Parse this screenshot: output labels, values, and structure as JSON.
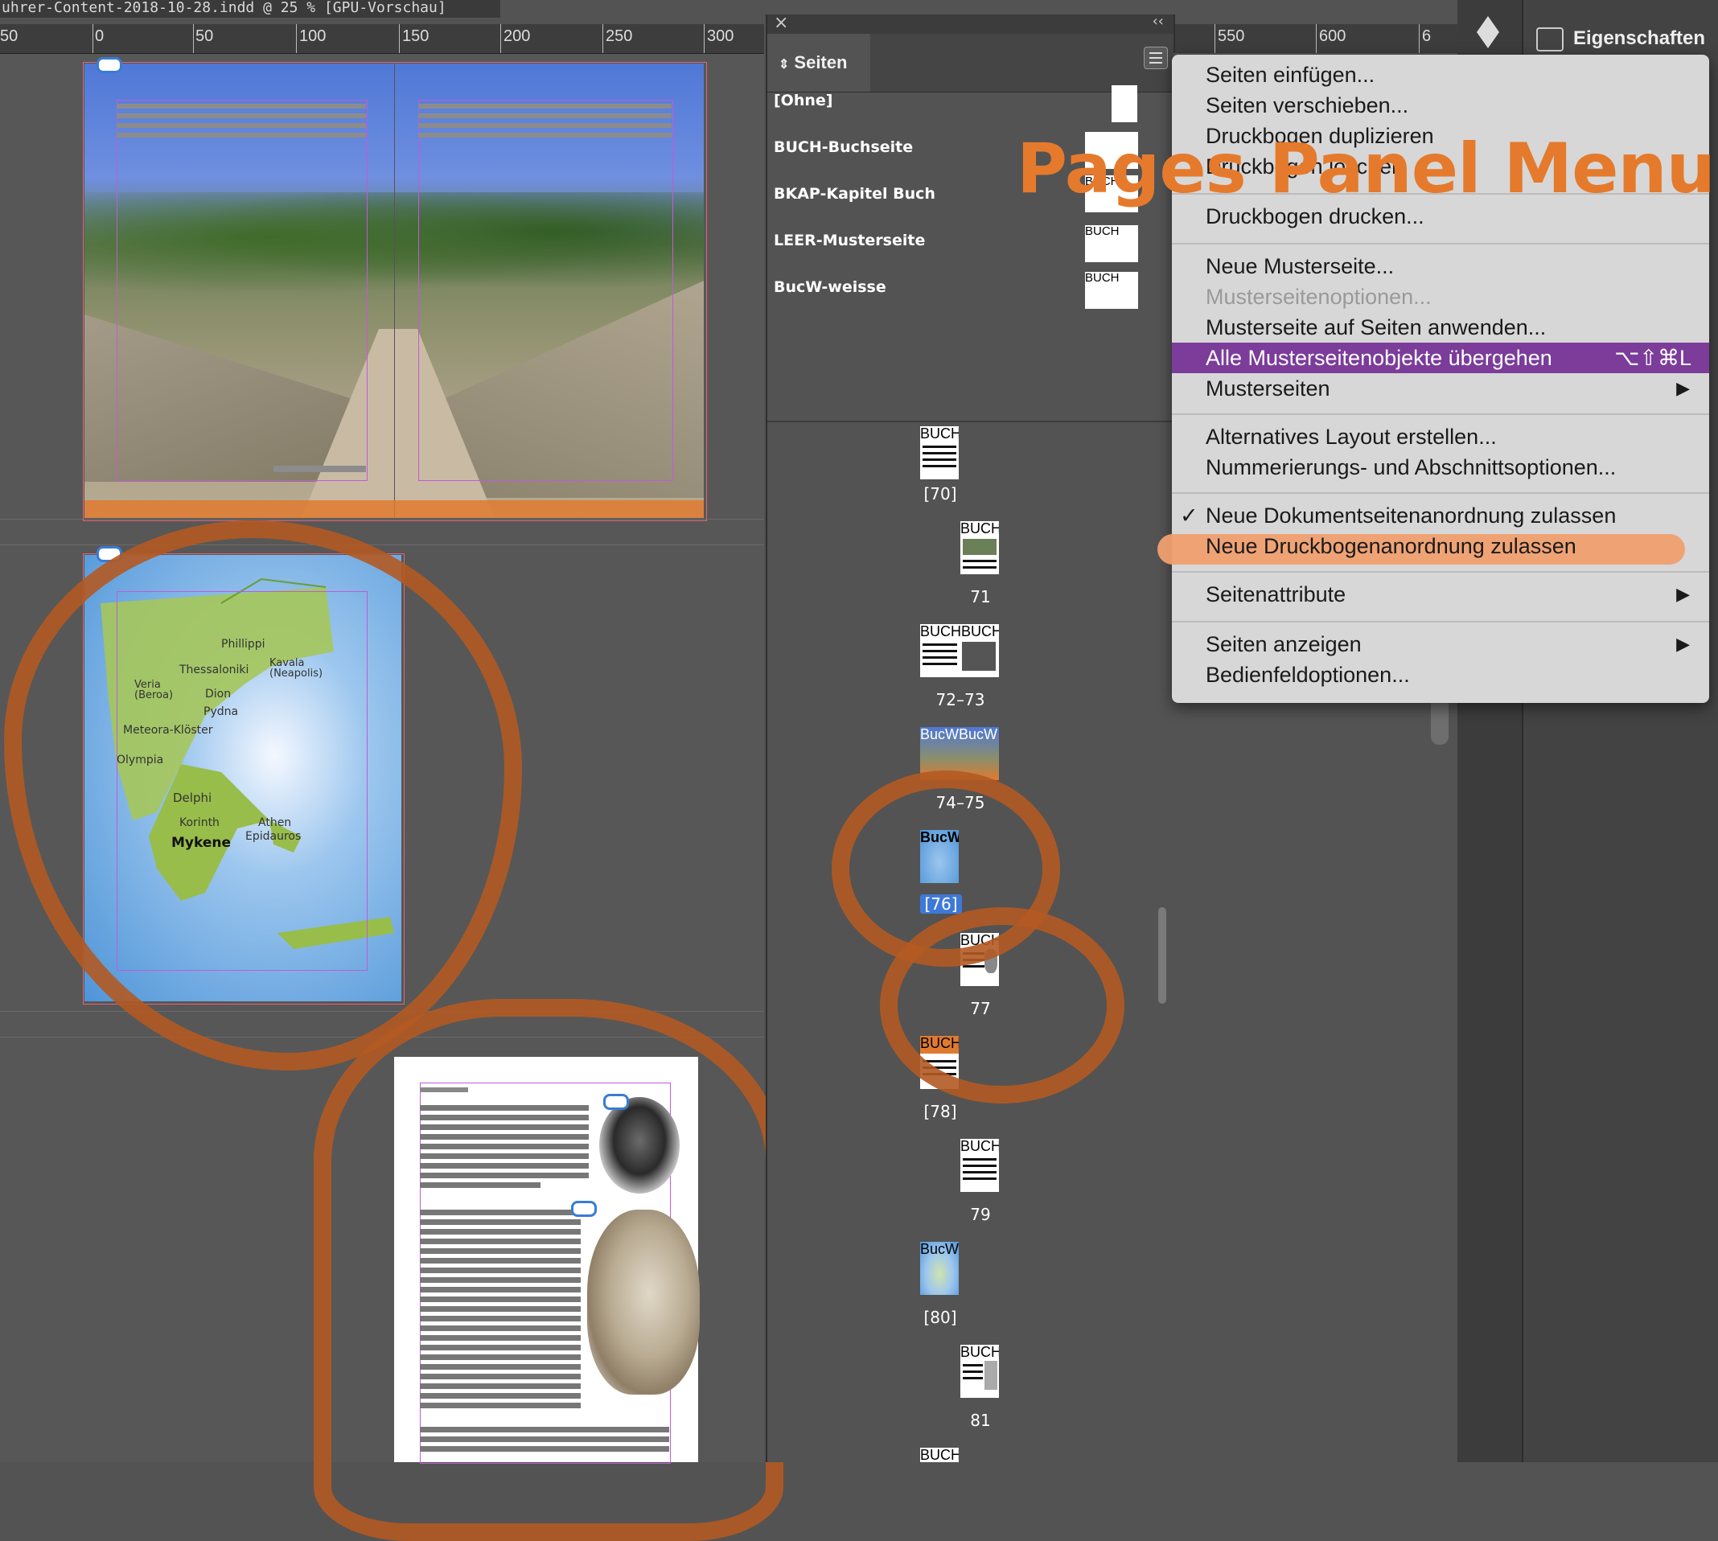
{
  "window": {
    "doc_title": "uhrer-Content-2018-10-28.indd @ 25 % [GPU-Vorschau]"
  },
  "ruler": {
    "labels": [
      "50",
      "0",
      "50",
      "100",
      "150",
      "200",
      "250",
      "300"
    ],
    "labels_right": [
      "550",
      "600",
      "6"
    ]
  },
  "pages_panel": {
    "tab_label": "Seiten",
    "masters": [
      {
        "label": "[Ohne]",
        "thumb": ""
      },
      {
        "label": "BUCH-Buchseite",
        "thumb": ""
      },
      {
        "label": "BKAP-Kapitel Buch",
        "thumb": "BUCH"
      },
      {
        "label": "LEER-Musterseite",
        "thumb": "BUCH"
      },
      {
        "label": "BucW-weisse",
        "thumb": "BUCH"
      }
    ],
    "pages": [
      {
        "num": "[70]",
        "thumb": "BUCH"
      },
      {
        "num": "71",
        "thumb": "BUCH"
      },
      {
        "num": "72–73",
        "thumb": "BUCHBUCH"
      },
      {
        "num": "74–75",
        "thumb": "BucWBucW"
      },
      {
        "num": "[76]",
        "thumb": "BucW"
      },
      {
        "num": "77",
        "thumb": "BUCH"
      },
      {
        "num": "[78]",
        "thumb": "BUCH"
      },
      {
        "num": "79",
        "thumb": "BUCH"
      },
      {
        "num": "[80]",
        "thumb": "BucW"
      },
      {
        "num": "81",
        "thumb": "BUCH"
      },
      {
        "num": "",
        "thumb": "BUCH"
      }
    ]
  },
  "dock": {
    "properties_label": "Eigenschaften"
  },
  "menu": {
    "items": [
      {
        "label": "Seiten einfügen..."
      },
      {
        "label": "Seiten verschieben..."
      },
      {
        "label": "Druckbogen duplizieren"
      },
      {
        "label": "Druckbogen löschen"
      },
      {
        "label": "Druckbogen drucken..."
      },
      {
        "label": "Neue Musterseite..."
      },
      {
        "label": "Musterseitenoptionen..."
      },
      {
        "label": "Musterseite auf Seiten anwenden..."
      },
      {
        "label": "Alle Musterseitenobjekte übergehen",
        "shortcut": "⌥⇧⌘L"
      },
      {
        "label": "Musterseiten"
      },
      {
        "label": "Alternatives Layout erstellen..."
      },
      {
        "label": "Nummerierungs- und Abschnittsoptionen..."
      },
      {
        "label": "Neue Dokumentseitenanordnung zulassen",
        "check": "✓"
      },
      {
        "label": "Neue Druckbogenanordnung zulassen"
      },
      {
        "label": "Seitenattribute"
      },
      {
        "label": "Seiten anzeigen"
      },
      {
        "label": "Bedienfeldoptionen..."
      }
    ],
    "submenu_arrow": "▶"
  },
  "annotation": {
    "text": "Pages Panel Menu"
  },
  "map_labels": {
    "places": [
      "Phillippi",
      "Thessaloniki",
      "Kavala (Neapolis)",
      "Veria (Beroa)",
      "Dion",
      "Pydna",
      "Meteora-Klöster",
      "Olympia",
      "Delphi",
      "Korinth",
      "Athen",
      "Epidauros",
      "Mykene"
    ]
  },
  "colors": {
    "accent_selected": "#7b3c9a",
    "annotation_orange": "#e57a2c",
    "scribble_brown": "#b25a22",
    "page_selected_blue": "#3f79d8"
  }
}
